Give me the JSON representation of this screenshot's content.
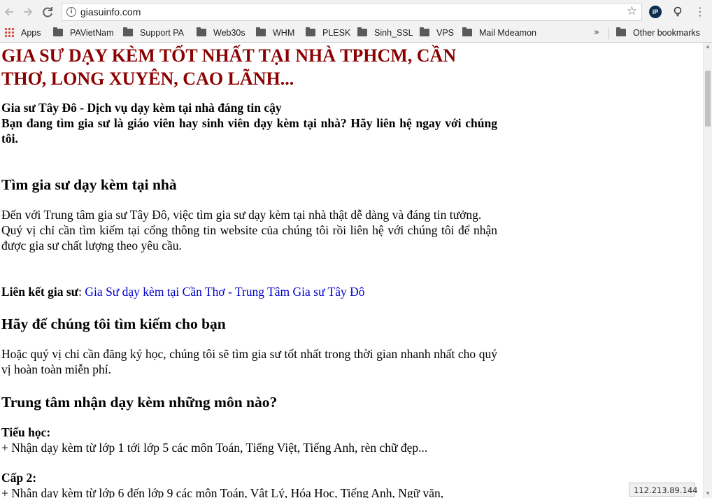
{
  "browser": {
    "url": "giasuinfo.com",
    "back_icon": "arrow-left",
    "forward_icon": "arrow-right",
    "reload_icon": "reload",
    "info_icon": "i",
    "star_icon": "☆",
    "ext_ip_label": "iP",
    "ext_bulb_icon": "bulb",
    "menu_icon": "⋮"
  },
  "bookmarks": {
    "items": [
      "Apps",
      "PAVietNam",
      "Support PA",
      "Web30s",
      "WHM",
      "PLESK",
      "Sinh_SSL",
      "VPS",
      "Mail Mdeamon"
    ],
    "overflow": "»",
    "other": "Other bookmarks"
  },
  "page": {
    "title": "GIA SƯ DẠY KÈM TỐT NHẤT TẠI NHÀ TPHCM, CẦN THƠ, LONG XUYÊN, CAO LÃNH...",
    "intro_line1": "Gia sư Tây Đô - Dịch vụ dạy kèm tại nhà đáng tin cậy",
    "intro_line2": "Bạn đang tìm gia sư là giáo viên hay sinh viên dạy kèm tại nhà? Hãy liên hệ ngay với chúng tôi.",
    "section1_heading": "Tìm gia sư dạy kèm tại nhà",
    "section1_p1": "Đến với Trung tâm gia sư Tây Đô, việc tìm gia sư dạy kèm tại nhà thật dễ dàng và đáng tin tưởng.",
    "section1_p2": "Quý vị chỉ cần tìm kiếm tại cổng thông tin website của chúng tôi rồi liên hệ với chúng tôi để nhận được gia sư chất lượng theo yêu cầu.",
    "link_label": "Liên kết gia sư",
    "link_colon": ": ",
    "link_text": "Gia Sư dạy kèm tại Cần Thơ - Trung Tâm Gia sư Tây Đô",
    "section2_heading": "Hãy để chúng tôi tìm kiếm cho bạn",
    "section2_p": "Hoặc quý vị chỉ cần đăng ký học, chúng tôi sẽ tìm gia sư tốt nhất trong thời gian nhanh nhất cho quý vị hoàn toàn miễn phí.",
    "section3_heading": "Trung tâm nhận dạy kèm những môn nào?",
    "primary_label": "Tiểu học:",
    "primary_text": "+ Nhận dạy kèm từ lớp 1 tới lớp 5 các môn Toán, Tiếng Việt, Tiếng Anh, rèn chữ đẹp...",
    "secondary_label": "Cấp 2:",
    "secondary_text": "+ Nhận dạy kèm từ lớp 6 đến lớp 9 các môn Toán, Vật Lý, Hóa Học, Tiếng Anh, Ngữ văn,"
  },
  "status": {
    "ip": "112.213.89.144"
  },
  "colors": {
    "title": "#8b0000",
    "link": "#0000cc",
    "toolbar_bg": "#f2f2f2"
  }
}
